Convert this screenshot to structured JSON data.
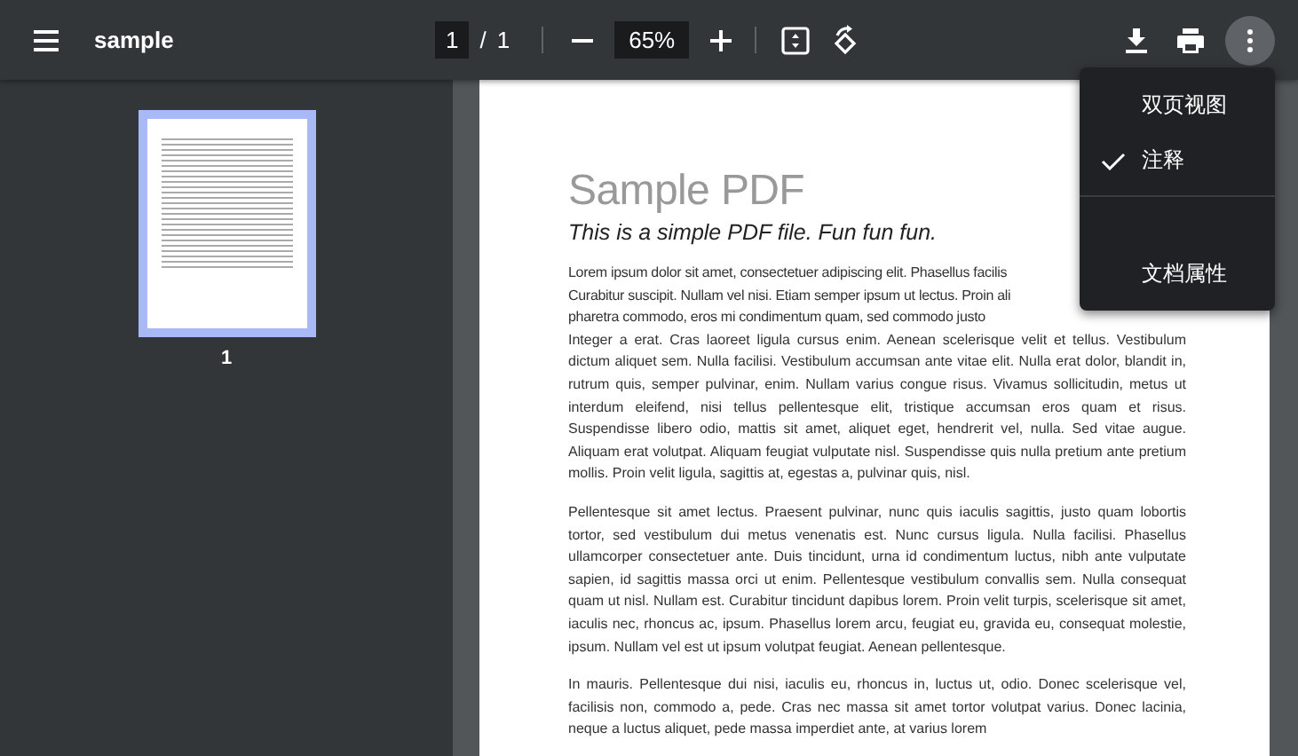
{
  "toolbar": {
    "title": "sample",
    "page_input": "1",
    "page_separator": "/",
    "page_total": "1",
    "zoom": "65%",
    "more_button": {
      "active": true
    }
  },
  "sidebar": {
    "thumbnails": [
      {
        "label": "1",
        "selected": true
      }
    ]
  },
  "document": {
    "title": "Sample PDF",
    "subtitle": "This is a simple PDF file. Fun fun fun.",
    "paragraphs": [
      {
        "kind": "lines",
        "lines": [
          "Lorem ipsum dolor sit amet, consectetuer adipiscing elit. Phasellus facilis",
          "Curabitur suscipit. Nullam vel nisi. Etiam semper ipsum ut lectus. Proin ali",
          "pharetra commodo, eros mi condimentum quam, sed commodo justo"
        ]
      },
      {
        "kind": "text",
        "text": "Integer a erat. Cras laoreet ligula cursus enim. Aenean scelerisque velit et tellus. Vestibulum dictum aliquet sem. Nulla facilisi. Vestibulum accumsan ante vitae elit. Nulla erat dolor, blandit in, rutrum quis, semper pulvinar, enim. Nullam varius congue risus. Vivamus sollicitudin, metus ut interdum eleifend, nisi tellus pellentesque elit, tristique accumsan eros quam et risus. Suspendisse libero odio, mattis sit amet, aliquet eget, hendrerit vel, nulla. Sed vitae augue. Aliquam erat volutpat. Aliquam feugiat vulputate nisl. Suspendisse quis nulla pretium ante pretium mollis. Proin velit ligula, sagittis at, egestas a, pulvinar quis, nisl."
      },
      {
        "kind": "text",
        "text": "Pellentesque sit amet lectus. Praesent pulvinar, nunc quis iaculis sagittis, justo quam lobortis tortor, sed vestibulum dui metus venenatis est. Nunc cursus ligula. Nulla facilisi. Phasellus ullamcorper consectetuer ante. Duis tincidunt, urna id condimentum luctus, nibh ante vulputate sapien, id sagittis massa orci ut enim. Pellentesque vestibulum convallis sem. Nulla consequat quam ut nisl. Nullam est. Curabitur tincidunt dapibus lorem. Proin velit turpis, scelerisque sit amet, iaculis nec, rhoncus ac, ipsum. Phasellus lorem arcu, feugiat eu, gravida eu, consequat molestie, ipsum. Nullam vel est ut ipsum volutpat feugiat. Aenean pellentesque."
      },
      {
        "kind": "text",
        "text": "In mauris. Pellentesque dui nisi, iaculis eu, rhoncus in, luctus ut, odio. Donec scelerisque vel, facilisis non, commodo a, pede. Cras nec massa sit amet tortor volutpat varius. Donec lacinia, neque a luctus aliquet, pede massa imperdiet ante, at varius lorem"
      }
    ]
  },
  "more_menu": {
    "open": true,
    "items": [
      {
        "kind": "check",
        "label": "双页视图",
        "checked": false
      },
      {
        "kind": "check",
        "label": "注释",
        "checked": true
      },
      {
        "kind": "separator"
      },
      {
        "kind": "action",
        "label": "文档属性"
      }
    ]
  }
}
